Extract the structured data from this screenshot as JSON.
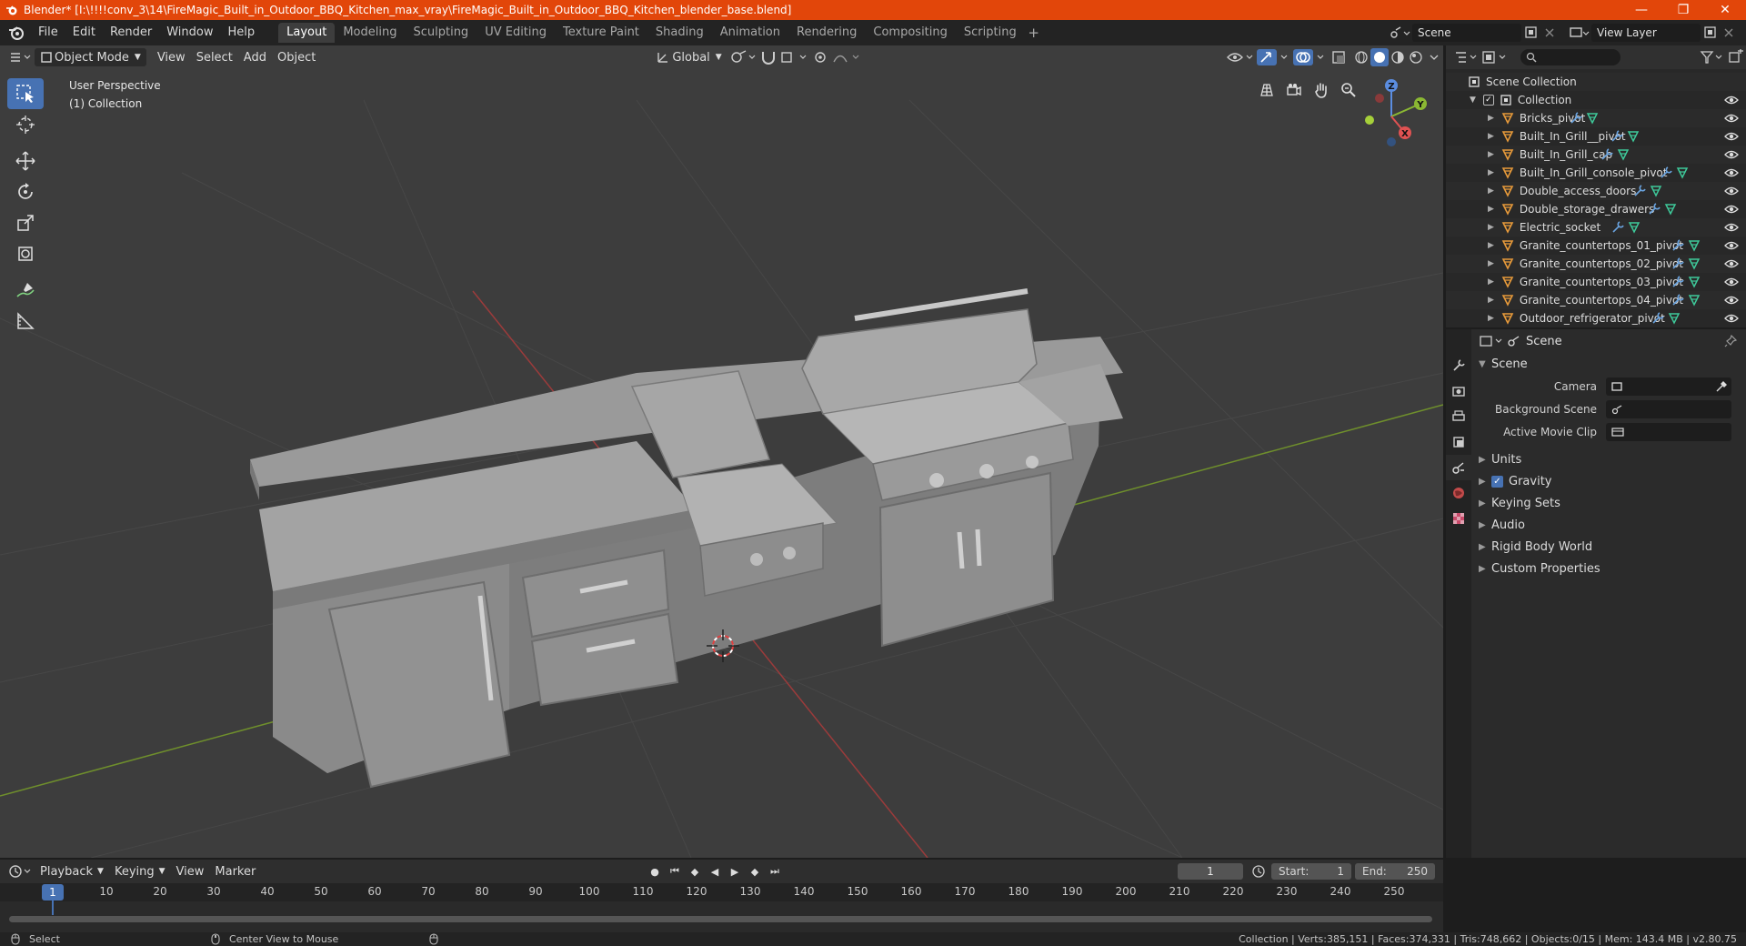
{
  "window": {
    "title": "Blender* [I:\\!!!!conv_3\\14\\FireMagic_Built_in_Outdoor_BBQ_Kitchen_max_vray\\FireMagic_Built_in_Outdoor_BBQ_Kitchen_blender_base.blend]",
    "minimize": "—",
    "maximize": "❐",
    "close": "✕"
  },
  "menu": {
    "items": [
      "File",
      "Edit",
      "Render",
      "Window",
      "Help"
    ]
  },
  "workspaces": {
    "tabs": [
      "Layout",
      "Modeling",
      "Sculpting",
      "UV Editing",
      "Texture Paint",
      "Shading",
      "Animation",
      "Rendering",
      "Compositing",
      "Scripting"
    ],
    "active": "Layout",
    "add": "+"
  },
  "scene_selector": {
    "value": "Scene"
  },
  "view_layer_selector": {
    "value": "View Layer"
  },
  "viewport": {
    "mode": "Object Mode",
    "menus": [
      "View",
      "Select",
      "Add",
      "Object"
    ],
    "transform_orientation": "Global",
    "info_line1": "User Perspective",
    "info_line2": "(1) Collection",
    "colors": {
      "background": "#3d3d3d",
      "grid": "#474747",
      "x_axis": "#9c3b3b",
      "y_axis": "#6f8f2c",
      "model": "#8f8f8f"
    }
  },
  "gizmo": {
    "z": "Z",
    "y": "Y",
    "x": "X"
  },
  "outliner": {
    "scene_collection": "Scene Collection",
    "collection": "Collection",
    "objects": [
      "Bricks_pivot",
      "Built_In_Grill__pivot",
      "Built_In_Grill_cap",
      "Built_In_Grill_console_pivot",
      "Double_access_doors",
      "Double_storage_drawers",
      "Electric_socket",
      "Granite_countertops_01_pivot",
      "Granite_countertops_02_pivot",
      "Granite_countertops_03_pivot",
      "Granite_countertops_04_pivot",
      "Outdoor_refrigerator_pivot"
    ]
  },
  "properties": {
    "context": "Scene",
    "panel": "Scene",
    "fields": {
      "camera": "Camera",
      "background_scene": "Background Scene",
      "active_movie_clip": "Active Movie Clip"
    },
    "subpanels": [
      "Units",
      "Gravity",
      "Keying Sets",
      "Audio",
      "Rigid Body World",
      "Custom Properties"
    ]
  },
  "timeline": {
    "menus": [
      "Playback",
      "Keying",
      "View",
      "Marker"
    ],
    "current_frame": "1",
    "start_label": "Start:",
    "start_value": "1",
    "end_label": "End:",
    "end_value": "250",
    "ruler": [
      "1",
      "10",
      "20",
      "30",
      "40",
      "50",
      "60",
      "70",
      "80",
      "90",
      "100",
      "110",
      "120",
      "130",
      "140",
      "150",
      "160",
      "170",
      "180",
      "190",
      "200",
      "210",
      "220",
      "230",
      "240",
      "250"
    ]
  },
  "status": {
    "left_action": "Select",
    "mid_action": "Center View to Mouse",
    "stats": "Collection | Verts:385,151 | Faces:374,331 | Tris:748,662 | Objects:0/15 | Mem: 143.4 MB | v2.80.75"
  }
}
